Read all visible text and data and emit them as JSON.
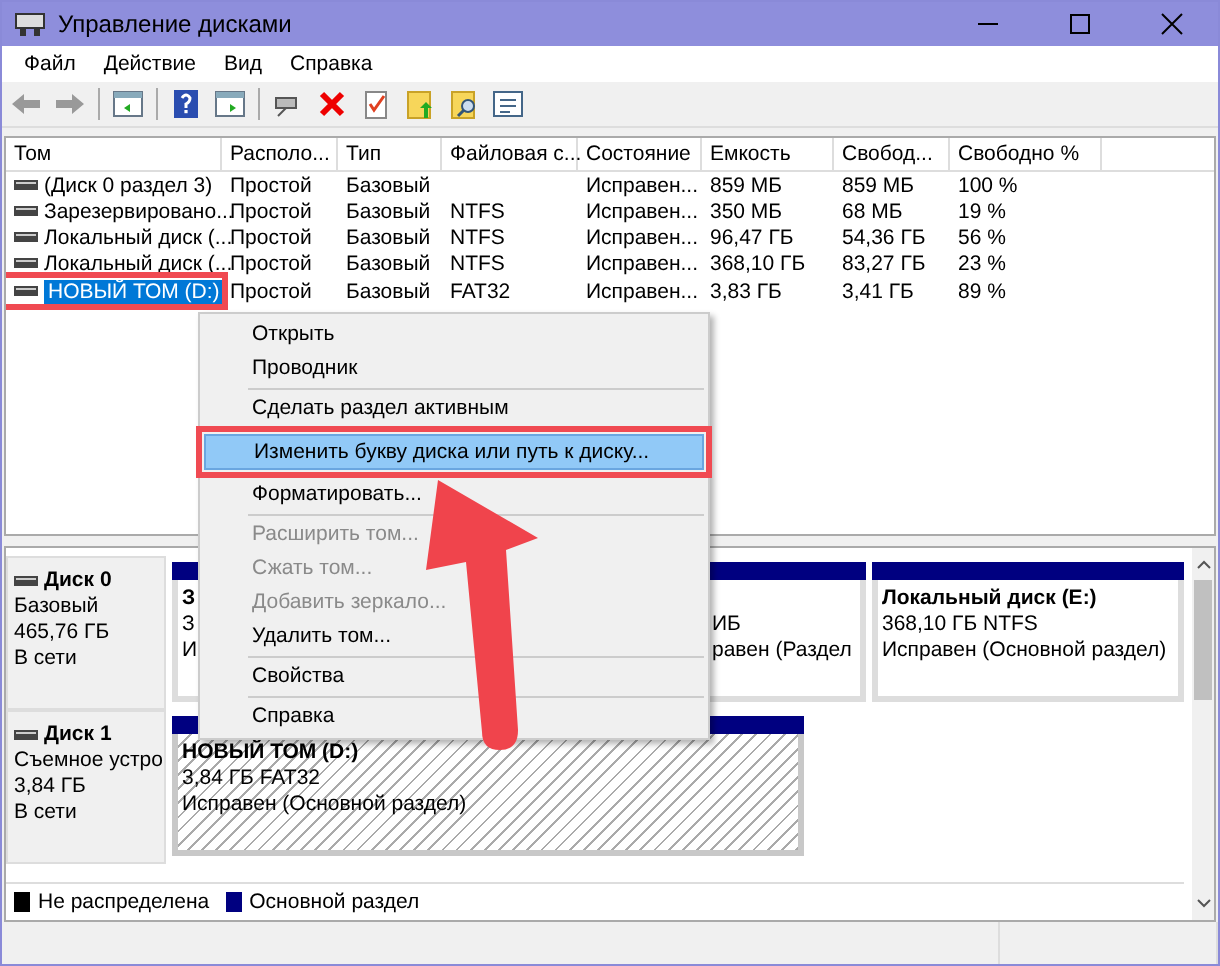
{
  "window": {
    "title": "Управление дисками"
  },
  "menu": [
    "Файл",
    "Действие",
    "Вид",
    "Справка"
  ],
  "table": {
    "columns": [
      "Том",
      "Располо...",
      "Тип",
      "Файловая с...",
      "Состояние",
      "Емкость",
      "Свобод...",
      "Свободно %"
    ],
    "rows": [
      {
        "cells": [
          "(Диск 0 раздел 3)",
          "Простой",
          "Базовый",
          "",
          "Исправен...",
          "859 МБ",
          "859 МБ",
          "100 %"
        ],
        "selected": false
      },
      {
        "cells": [
          "Зарезервировано...",
          "Простой",
          "Базовый",
          "NTFS",
          "Исправен...",
          "350 МБ",
          "68 МБ",
          "19 %"
        ],
        "selected": false
      },
      {
        "cells": [
          "Локальный диск (...",
          "Простой",
          "Базовый",
          "NTFS",
          "Исправен...",
          "96,47 ГБ",
          "54,36 ГБ",
          "56 %"
        ],
        "selected": false
      },
      {
        "cells": [
          "Локальный диск (...",
          "Простой",
          "Базовый",
          "NTFS",
          "Исправен...",
          "368,10 ГБ",
          "83,27 ГБ",
          "23 %"
        ],
        "selected": false
      },
      {
        "cells": [
          "НОВЫЙ ТОМ (D:)",
          "Простой",
          "Базовый",
          "FAT32",
          "Исправен...",
          "3,83 ГБ",
          "3,41 ГБ",
          "89 %"
        ],
        "selected": true
      }
    ]
  },
  "disks": [
    {
      "name": "Диск 0",
      "type": "Базовый",
      "size": "465,76 ГБ",
      "status": "В сети",
      "partitions": [
        {
          "title": "З",
          "lines": [
            "З",
            "И"
          ],
          "selected": false
        },
        {
          "lines": [
            "ИБ",
            "равен (Раздел"
          ],
          "selected": false
        },
        {
          "title": "Локальный диск  (E:)",
          "lines": [
            "368,10 ГБ NTFS",
            "Исправен (Основной раздел)"
          ],
          "selected": false
        }
      ]
    },
    {
      "name": "Диск 1",
      "type": "Съемное устро",
      "size": "3,84 ГБ",
      "status": "В сети",
      "partitions": [
        {
          "title": "НОВЫЙ ТОМ  (D:)",
          "lines": [
            "3,84 ГБ FAT32",
            "Исправен (Основной раздел)"
          ],
          "selected": true
        }
      ]
    }
  ],
  "legend": [
    {
      "label": "Не распределена",
      "color": "#000000"
    },
    {
      "label": "Основной раздел",
      "color": "#000080"
    }
  ],
  "context_menu": [
    {
      "kind": "item",
      "label": "Открыть",
      "disabled": false,
      "selected": false
    },
    {
      "kind": "item",
      "label": "Проводник",
      "disabled": false,
      "selected": false
    },
    {
      "kind": "separator"
    },
    {
      "kind": "item",
      "label": "Сделать раздел активным",
      "disabled": false,
      "selected": false
    },
    {
      "kind": "item",
      "label": "Изменить букву диска или путь к диску...",
      "disabled": false,
      "selected": true
    },
    {
      "kind": "item",
      "label": "Форматировать...",
      "disabled": false,
      "selected": false
    },
    {
      "kind": "separator"
    },
    {
      "kind": "item",
      "label": "Расширить том...",
      "disabled": true,
      "selected": false
    },
    {
      "kind": "item",
      "label": "Сжать том...",
      "disabled": true,
      "selected": false
    },
    {
      "kind": "item",
      "label": "Добавить зеркало...",
      "disabled": true,
      "selected": false
    },
    {
      "kind": "item",
      "label": "Удалить том...",
      "disabled": false,
      "selected": false
    },
    {
      "kind": "separator"
    },
    {
      "kind": "item",
      "label": "Свойства",
      "disabled": false,
      "selected": false
    },
    {
      "kind": "separator"
    },
    {
      "kind": "item",
      "label": "Справка",
      "disabled": false,
      "selected": false
    }
  ]
}
